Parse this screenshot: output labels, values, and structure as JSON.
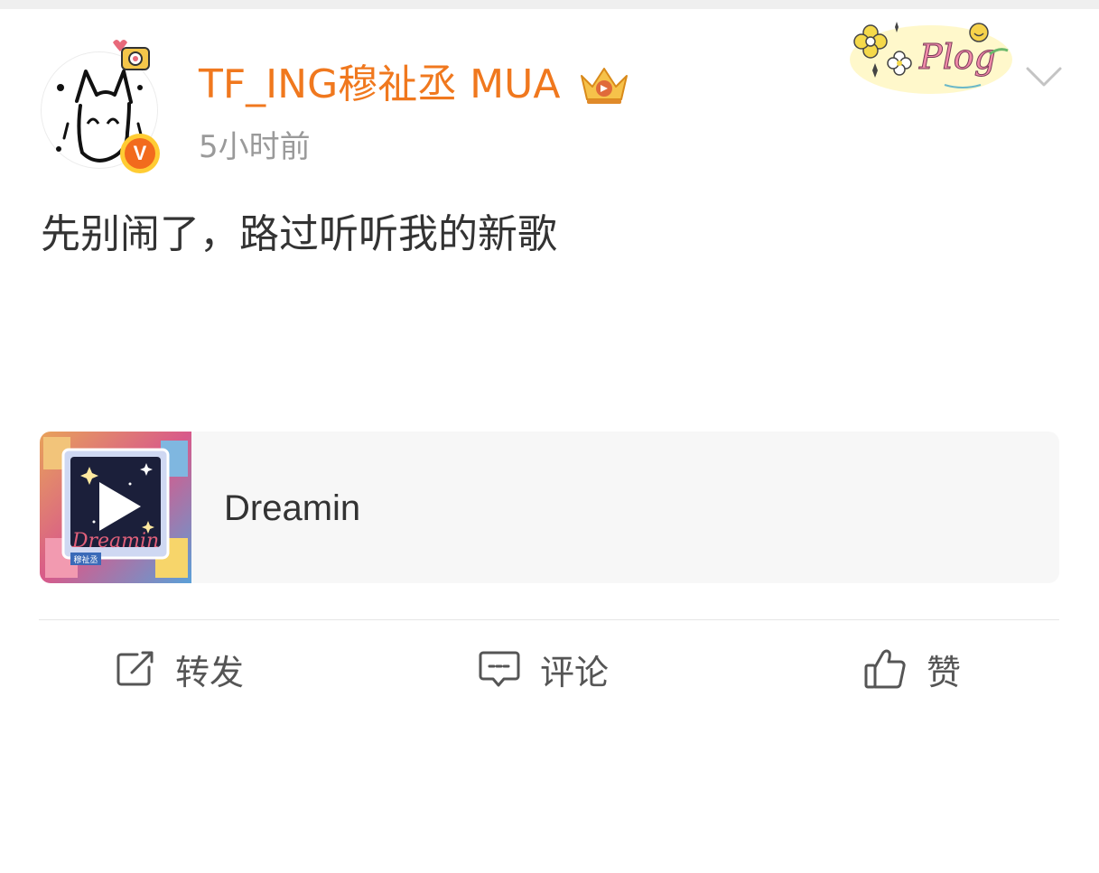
{
  "post": {
    "author": {
      "name": "TF_ING穆祉丞 MUA",
      "verified_badge": "V"
    },
    "timestamp": "5小时前",
    "decoration_badge": "Plog",
    "text": "先别闹了，路过听听我的新歌"
  },
  "music_card": {
    "title": "Dreamin",
    "cover_title": "Dreamin",
    "cover_artist": "穆祉丞"
  },
  "actions": {
    "repost_label": "转发",
    "comment_label": "评论",
    "like_label": "赞"
  },
  "icons": {
    "repost": "share-icon",
    "comment": "comment-icon",
    "like": "thumbs-up-icon",
    "more": "chevron-down-icon",
    "vip": "crown-icon"
  },
  "colors": {
    "username": "#f0781e",
    "timestamp": "#9a9a9a",
    "text": "#333333",
    "card_bg": "#f7f7f7",
    "verified": "#f26b1d"
  }
}
